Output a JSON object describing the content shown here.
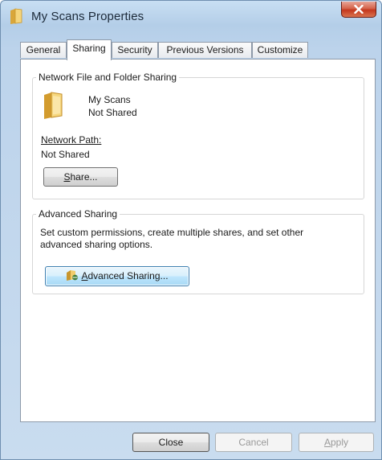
{
  "window": {
    "title": "My Scans Properties"
  },
  "tabs": [
    {
      "label": "General",
      "active": false
    },
    {
      "label": "Sharing",
      "active": true
    },
    {
      "label": "Security",
      "active": false
    },
    {
      "label": "Previous Versions",
      "active": false
    },
    {
      "label": "Customize",
      "active": false
    }
  ],
  "network_sharing": {
    "group_title": "Network File and Folder Sharing",
    "folder_name": "My Scans",
    "share_status": "Not Shared",
    "path_label": "Network Path:",
    "path_value": "Not Shared",
    "share_button_accel": "S",
    "share_button_rest": "hare..."
  },
  "advanced_sharing": {
    "group_title": "Advanced Sharing",
    "description_line1": "Set custom permissions, create multiple shares, and set other",
    "description_line2": "advanced sharing options.",
    "button_accel": "A",
    "button_rest": "dvanced Sharing..."
  },
  "footer": {
    "close_label": "Close",
    "cancel_label": "Cancel",
    "apply_accel": "A",
    "apply_rest": "pply"
  }
}
